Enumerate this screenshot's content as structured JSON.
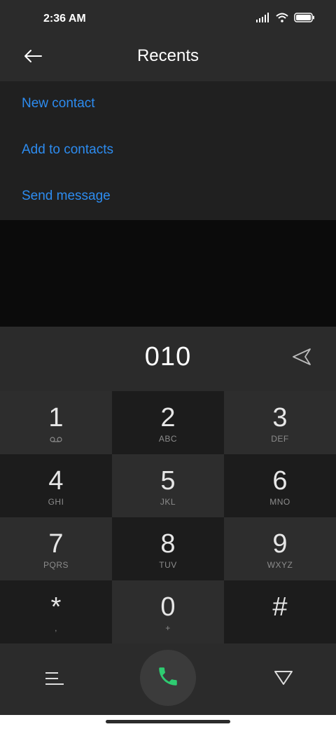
{
  "status_bar": {
    "time": "2:36 AM",
    "signal_icon": "signal-icon",
    "wifi_icon": "wifi-icon",
    "battery_icon": "battery-icon"
  },
  "app_bar": {
    "back_icon": "back-arrow-icon",
    "title": "Recents"
  },
  "menu": {
    "items": [
      {
        "label": "New contact"
      },
      {
        "label": "Add to contacts"
      },
      {
        "label": "Send message"
      }
    ]
  },
  "dialer": {
    "number": "010",
    "send_icon": "send-icon"
  },
  "keypad": {
    "keys": [
      {
        "digit": "1",
        "sub": "",
        "sub_icon": "voicemail-icon"
      },
      {
        "digit": "2",
        "sub": "ABC"
      },
      {
        "digit": "3",
        "sub": "DEF"
      },
      {
        "digit": "4",
        "sub": "GHI"
      },
      {
        "digit": "5",
        "sub": "JKL"
      },
      {
        "digit": "6",
        "sub": "MNO"
      },
      {
        "digit": "7",
        "sub": "PQRS"
      },
      {
        "digit": "8",
        "sub": "TUV"
      },
      {
        "digit": "9",
        "sub": "WXYZ"
      },
      {
        "digit": "*",
        "sub": ","
      },
      {
        "digit": "0",
        "sub": "+"
      },
      {
        "digit": "#",
        "sub": ""
      }
    ]
  },
  "bottom_bar": {
    "menu_icon": "menu-icon",
    "call_icon": "phone-icon",
    "collapse_icon": "collapse-keypad-icon"
  },
  "colors": {
    "accent": "#2d8cf0",
    "call_green": "#2ecc71",
    "background": "#2b2b2b"
  }
}
